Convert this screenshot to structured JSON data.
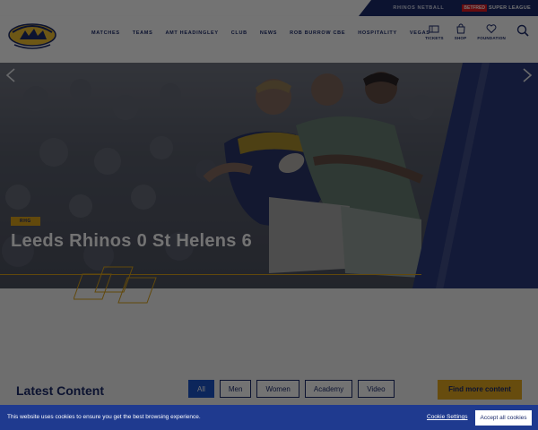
{
  "topbar": {
    "netball_label": "RHINOS NETBALL",
    "betfred_label": "BETFRED",
    "league_label": "SUPER LEAGUE"
  },
  "header": {
    "nav": [
      {
        "label": "MATCHES"
      },
      {
        "label": "TEAMS"
      },
      {
        "label": "AMT HEADINGLEY"
      },
      {
        "label": "CLUB"
      },
      {
        "label": "NEWS"
      },
      {
        "label": "ROB BURROW CBE"
      },
      {
        "label": "HOSPITALITY"
      },
      {
        "label": "VEGAS"
      }
    ],
    "tools": {
      "tickets": "TICKETS",
      "shop": "SHOP",
      "foundation": "FOUNDATION"
    }
  },
  "hero": {
    "tag": "RHG",
    "title": "Leeds Rhinos 0 St Helens 6",
    "slides_total": 3,
    "active_slide": 2
  },
  "latest": {
    "title": "Latest Content",
    "filters": [
      {
        "label": "All",
        "active": true
      },
      {
        "label": "Men",
        "active": false
      },
      {
        "label": "Women",
        "active": false
      },
      {
        "label": "Academy",
        "active": false
      },
      {
        "label": "Video",
        "active": false
      }
    ],
    "find_more": "Find more content"
  },
  "cookie": {
    "message": "This website uses cookies to ensure you get the best browsing experience.",
    "settings_label": "Cookie Settings",
    "accept_label": "Accept all cookies"
  },
  "colors": {
    "navy": "#1c2b6b",
    "amber": "#e5a81f",
    "blue": "#1c56c9",
    "cookie_bg": "#1f3a8f"
  }
}
